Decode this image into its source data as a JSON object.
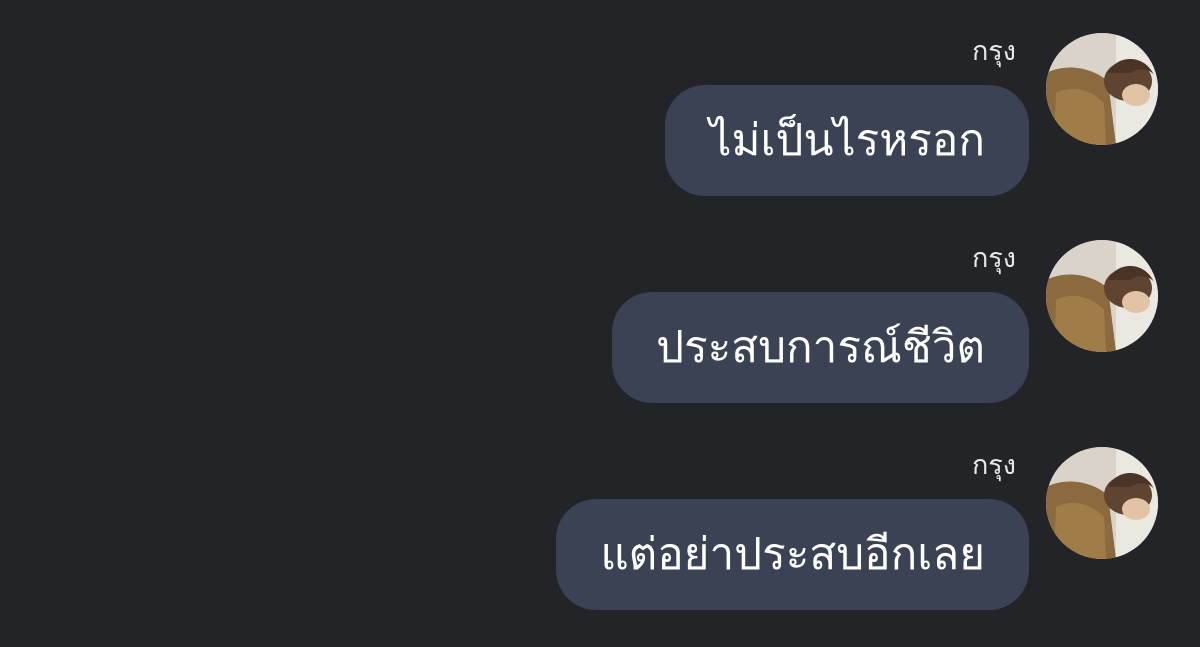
{
  "chat": {
    "messages": [
      {
        "sender": "กรุง",
        "text": "ไม่เป็นไรหรอก",
        "avatar_icon": "user-photo-avatar"
      },
      {
        "sender": "กรุง",
        "text": "ประสบการณ์ชีวิต",
        "avatar_icon": "user-photo-avatar"
      },
      {
        "sender": "กรุง",
        "text": "แต่อย่าประสบอีกเลย",
        "avatar_icon": "user-photo-avatar"
      }
    ]
  },
  "colors": {
    "background": "#232428",
    "bubble": "#3b4253",
    "bubble_text": "#ffffff",
    "sender_text": "#e8e8e8"
  }
}
